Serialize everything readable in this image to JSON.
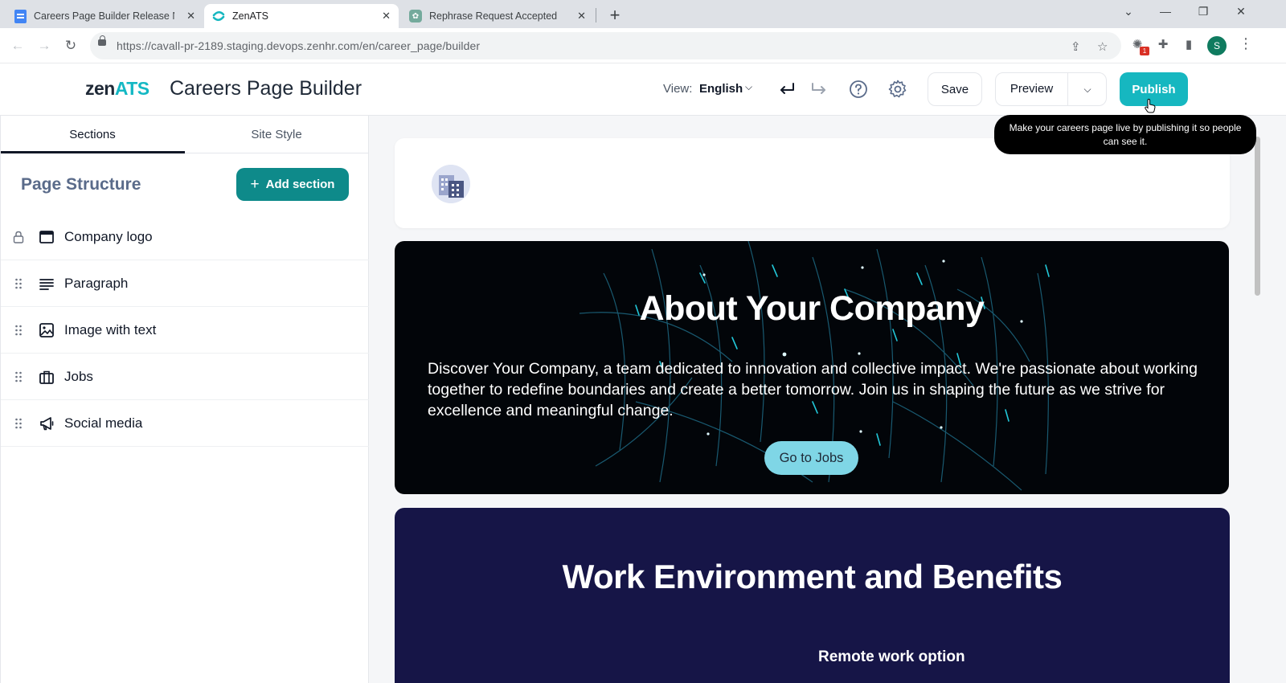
{
  "browser": {
    "tabs": [
      {
        "title": "Careers Page Builder Release No",
        "icon": "google-docs-icon"
      },
      {
        "title": "ZenATS",
        "icon": "zenats-icon"
      },
      {
        "title": "Rephrase Request Accepted",
        "icon": "chatgpt-icon"
      }
    ],
    "url": "https://cavall-pr-2189.staging.devops.zenhr.com/en/career_page/builder",
    "profile_initial": "S",
    "extension_badge": "1"
  },
  "header": {
    "logo_main": "zen",
    "logo_accent": "ATS",
    "title": "Careers Page Builder",
    "view_label": "View:",
    "view_value": "English",
    "save_label": "Save",
    "preview_label": "Preview",
    "publish_label": "Publish",
    "tooltip": "Make your careers page live by publishing it so people can see it."
  },
  "sidebar": {
    "tabs": [
      "Sections",
      "Site Style"
    ],
    "title": "Page Structure",
    "add_label": "Add section",
    "sections": [
      {
        "label": "Company logo",
        "icon": "browser-window-icon",
        "locked": true
      },
      {
        "label": "Paragraph",
        "icon": "align-left-icon",
        "locked": false
      },
      {
        "label": "Image with text",
        "icon": "image-icon",
        "locked": false
      },
      {
        "label": "Jobs",
        "icon": "briefcase-icon",
        "locked": false
      },
      {
        "label": "Social media",
        "icon": "megaphone-icon",
        "locked": false
      }
    ]
  },
  "preview": {
    "about_title": "About Your Company",
    "about_text": "Discover Your Company, a team dedicated to innovation and collective impact. We're passionate about working together to redefine boundaries and create a better tomorrow. Join us in shaping the future as we strive for excellence and meaningful change.",
    "jobs_button": "Go to Jobs",
    "work_title": "Work Environment and Benefits",
    "work_subtitle": "Remote work option"
  },
  "colors": {
    "brand_teal": "#16b7c0",
    "add_button": "#0e8a8a",
    "about_bg": "#020509",
    "work_bg": "#161547",
    "jobs_button": "#7fd6e6"
  }
}
